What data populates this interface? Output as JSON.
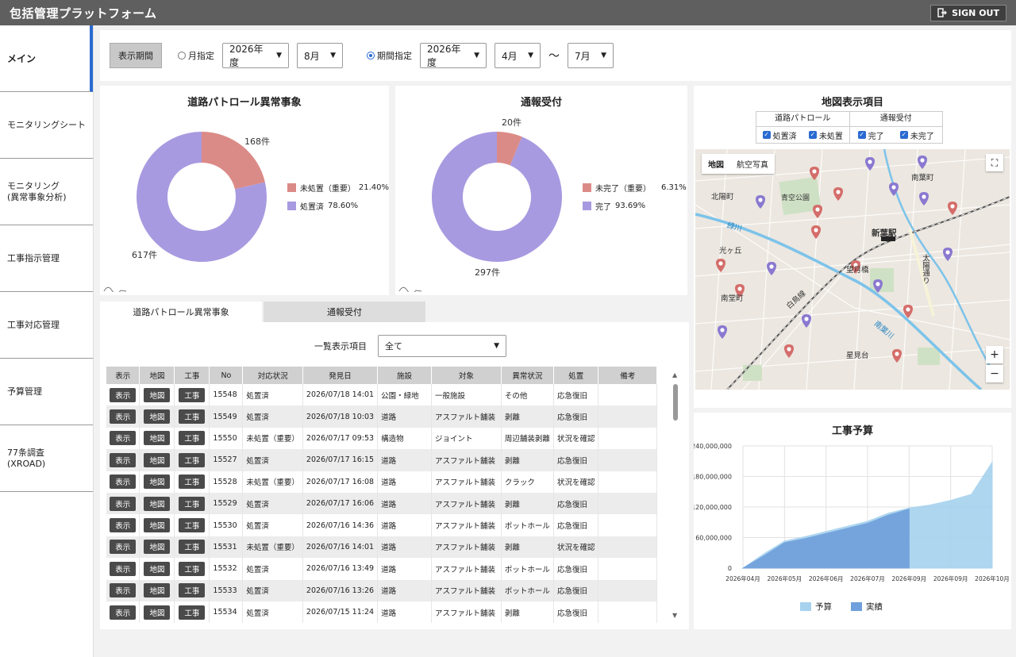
{
  "app": {
    "title": "包括管理プラットフォーム",
    "signout_label": "SIGN OUT"
  },
  "sidebar": {
    "items": [
      {
        "label": "メイン"
      },
      {
        "label": "モニタリングシート"
      },
      {
        "label": "モニタリング\n(異常事象分析)"
      },
      {
        "label": "工事指示管理"
      },
      {
        "label": "工事対応管理"
      },
      {
        "label": "予算管理"
      },
      {
        "label": "77条調査\n(XROAD)"
      }
    ]
  },
  "filter": {
    "period_label": "表示期間",
    "month_label": "月指定",
    "month_year": "2026年度",
    "month_value": "8月",
    "range_label": "期間指定",
    "range_year": "2026年度",
    "range_from": "4月",
    "tilde": "〜",
    "range_to": "7月"
  },
  "patrol_donut": {
    "title": "道路パトロール異常事象",
    "top_label": "168件",
    "bottom_label": "617件",
    "legend": [
      {
        "label": "未処置（重要）",
        "pct": "21.40%",
        "color": "#db8b87"
      },
      {
        "label": "処置済",
        "pct": "78.60%",
        "color": "#a89ae0"
      }
    ]
  },
  "report_donut": {
    "title": "通報受付",
    "top_label": "20件",
    "bottom_label": "297件",
    "legend": [
      {
        "label": "未完了（重要）",
        "pct": "6.31%",
        "color": "#db8b87"
      },
      {
        "label": "完了",
        "pct": "93.69%",
        "color": "#a89ae0"
      }
    ]
  },
  "chart_data": [
    {
      "type": "pie",
      "title": "道路パトロール異常事象",
      "categories": [
        "未処置（重要）",
        "処置済"
      ],
      "values": [
        168,
        617
      ],
      "percent": [
        21.4,
        78.6
      ]
    },
    {
      "type": "pie",
      "title": "通報受付",
      "categories": [
        "未完了（重要）",
        "完了"
      ],
      "values": [
        20,
        297
      ],
      "percent": [
        6.31,
        93.69
      ]
    },
    {
      "type": "area",
      "title": "工事予算",
      "x_ticks": [
        "2026年04月",
        "2026年05月",
        "2026年06月",
        "2026年07月",
        "2026年09月",
        "2026年09月",
        "2026年10月"
      ],
      "y_ticks": [
        "0",
        "60,000,000",
        "120,000,000",
        "180,000,000",
        "240,000,000"
      ],
      "ylim": [
        0,
        240000000
      ],
      "legend_placement": "bottom",
      "series": [
        {
          "name": "予算",
          "color": "#a6d2ee",
          "points": [
            [
              0,
              0
            ],
            [
              0.5,
              28000000
            ],
            [
              1,
              53000000
            ],
            [
              1.5,
              62000000
            ],
            [
              2,
              72000000
            ],
            [
              2.5,
              82000000
            ],
            [
              3,
              92000000
            ],
            [
              3.5,
              108000000
            ],
            [
              4,
              118000000
            ],
            [
              4.5,
              124000000
            ],
            [
              5,
              133000000
            ],
            [
              5.5,
              145000000
            ],
            [
              6,
              208000000
            ]
          ]
        },
        {
          "name": "実績",
          "color": "#6f9fdc",
          "points": [
            [
              0,
              0
            ],
            [
              0.5,
              24000000
            ],
            [
              1,
              50000000
            ],
            [
              1.5,
              58000000
            ],
            [
              2,
              68000000
            ],
            [
              2.5,
              78000000
            ],
            [
              3,
              88000000
            ],
            [
              3.5,
              104000000
            ],
            [
              4,
              116000000
            ]
          ]
        }
      ]
    }
  ],
  "tabs": [
    {
      "label": "道路パトロール異常事象"
    },
    {
      "label": "通報受付"
    }
  ],
  "list": {
    "selector_label": "一覧表示項目",
    "selector_value": "全て",
    "columns": [
      "表示",
      "地図",
      "工事",
      "No",
      "対応状況",
      "発見日",
      "施設",
      "対象",
      "異常状況",
      "処置",
      "備考"
    ],
    "btn_show": "表示",
    "btn_map": "地図",
    "btn_work": "工事",
    "rows": [
      {
        "no": "15548",
        "status": "処置済",
        "date": "2026/07/18 14:01",
        "facility": "公園・緑地",
        "target": "一般施設",
        "anomaly": "その他",
        "action": "応急復旧",
        "note": ""
      },
      {
        "no": "15549",
        "status": "処置済",
        "date": "2026/07/18 10:03",
        "facility": "道路",
        "target": "アスファルト舗装",
        "anomaly": "剥離",
        "action": "応急復旧",
        "note": ""
      },
      {
        "no": "15550",
        "status": "未処置（重要）",
        "date": "2026/07/17 09:53",
        "facility": "構造物",
        "target": "ジョイント",
        "anomaly": "周辺舗装剥離",
        "action": "状況を確認",
        "note": ""
      },
      {
        "no": "15527",
        "status": "処置済",
        "date": "2026/07/17 16:15",
        "facility": "道路",
        "target": "アスファルト舗装",
        "anomaly": "剥離",
        "action": "応急復旧",
        "note": ""
      },
      {
        "no": "15528",
        "status": "未処置（重要）",
        "date": "2026/07/17 16:08",
        "facility": "道路",
        "target": "アスファルト舗装",
        "anomaly": "クラック",
        "action": "状況を確認",
        "note": ""
      },
      {
        "no": "15529",
        "status": "処置済",
        "date": "2026/07/17 16:06",
        "facility": "道路",
        "target": "アスファルト舗装",
        "anomaly": "剥離",
        "action": "応急復旧",
        "note": ""
      },
      {
        "no": "15530",
        "status": "処置済",
        "date": "2026/07/16 14:36",
        "facility": "道路",
        "target": "アスファルト舗装",
        "anomaly": "ポットホール",
        "action": "応急復旧",
        "note": ""
      },
      {
        "no": "15531",
        "status": "未処置（重要）",
        "date": "2026/07/16 14:01",
        "facility": "道路",
        "target": "アスファルト舗装",
        "anomaly": "剥離",
        "action": "状況を確認",
        "note": ""
      },
      {
        "no": "15532",
        "status": "処置済",
        "date": "2026/07/16 13:49",
        "facility": "道路",
        "target": "アスファルト舗装",
        "anomaly": "ポットホール",
        "action": "応急復旧",
        "note": ""
      },
      {
        "no": "15533",
        "status": "処置済",
        "date": "2026/07/16 13:26",
        "facility": "道路",
        "target": "アスファルト舗装",
        "anomaly": "ポットホール",
        "action": "応急復旧",
        "note": ""
      },
      {
        "no": "15534",
        "status": "処置済",
        "date": "2026/07/15 11:24",
        "facility": "道路",
        "target": "アスファルト舗装",
        "anomaly": "剥離",
        "action": "応急復旧",
        "note": ""
      }
    ]
  },
  "map_panel": {
    "title": "地図表示項目",
    "group1": "道路パトロール",
    "group2": "通報受付",
    "cb1": "処置済",
    "cb2": "未処置",
    "cb3": "完了",
    "cb4": "未完了",
    "toggle_map": "地図",
    "toggle_aerial": "航空写真",
    "labels": [
      "南葉町",
      "北陽町",
      "青空公園",
      "新葉駅",
      "光ヶ丘",
      "望月橋",
      "太陽通り",
      "南堂町",
      "白鳥線",
      "緑川",
      "南葉川",
      "星見台"
    ],
    "pin_purple": "#8a78d0",
    "pin_red": "#d46d6a"
  },
  "budget_chart": {
    "title": "工事予算"
  }
}
